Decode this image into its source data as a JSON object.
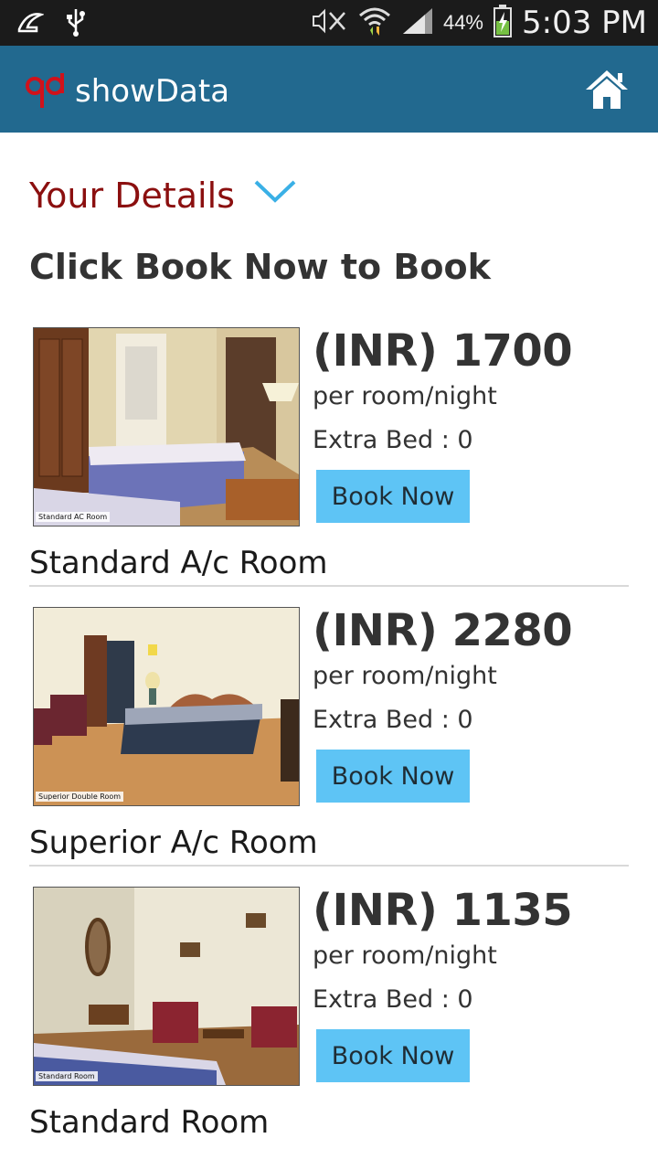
{
  "status_bar": {
    "battery_percent": "44%",
    "time": "5:03 PM",
    "icons": [
      "notification-icon",
      "usb-icon",
      "mute-icon",
      "wifi-icon",
      "signal-icon",
      "battery-charging-icon"
    ]
  },
  "app_bar": {
    "title": "showData",
    "logo_text": "qd",
    "home_icon": "home-icon",
    "color": "#22698f"
  },
  "details": {
    "title": "Your Details",
    "toggle_icon": "chevron-down-icon"
  },
  "instruction": "Click Book Now to Book",
  "rooms": [
    {
      "price": "(INR) 1700",
      "per_label": "per room/night",
      "extra_bed": "Extra Bed : 0",
      "button_label": "Book Now",
      "name": "Standard A/c Room",
      "photo_caption": "Standard AC Room"
    },
    {
      "price": "(INR) 2280",
      "per_label": "per room/night",
      "extra_bed": "Extra Bed : 0",
      "button_label": "Book Now",
      "name": "Superior A/c Room",
      "photo_caption": "Superior Double Room"
    },
    {
      "price": "(INR) 1135",
      "per_label": "per room/night",
      "extra_bed": "Extra Bed : 0",
      "button_label": "Book Now",
      "name": "Standard Room",
      "photo_caption": "Standard Room"
    }
  ],
  "colors": {
    "accent_button": "#5ec4f5",
    "details_title": "#8b0f0f",
    "chevron": "#3ab0e6"
  }
}
